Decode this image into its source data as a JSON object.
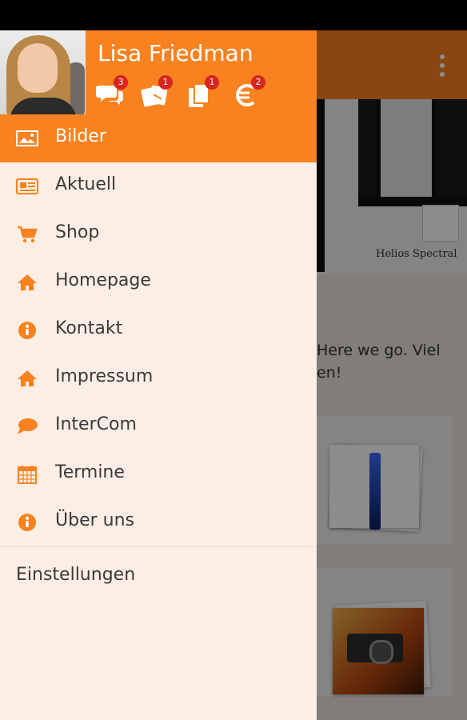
{
  "drawer": {
    "user_name": "Lisa Friedman",
    "header_icons": [
      {
        "icon": "chat-bubbles-icon",
        "count": "3"
      },
      {
        "icon": "coupons-icon",
        "count": "1"
      },
      {
        "icon": "documents-icon",
        "count": "1"
      },
      {
        "icon": "euro-icon",
        "count": "2"
      }
    ],
    "items": [
      {
        "label": "Bilder",
        "icon": "image-icon",
        "active": true
      },
      {
        "label": "Aktuell",
        "icon": "newspaper-icon"
      },
      {
        "label": "Shop",
        "icon": "cart-icon"
      },
      {
        "label": "Homepage",
        "icon": "home-icon"
      },
      {
        "label": "Kontakt",
        "icon": "info-icon"
      },
      {
        "label": "Impressum",
        "icon": "home-icon"
      },
      {
        "label": "InterCom",
        "icon": "chat-icon"
      },
      {
        "label": "Termine",
        "icon": "calendar-icon"
      },
      {
        "label": "Über uns",
        "icon": "info-icon"
      }
    ],
    "settings_label": "Einstellungen"
  },
  "background": {
    "hero_caption": "Helios Spectral",
    "intro_line1": "Here we go. Viel",
    "intro_line2": "en!"
  },
  "colors": {
    "accent": "#f7821f",
    "drawer_bg": "#fdeee5",
    "badge": "#d7261e",
    "icon": "#f7821f"
  }
}
